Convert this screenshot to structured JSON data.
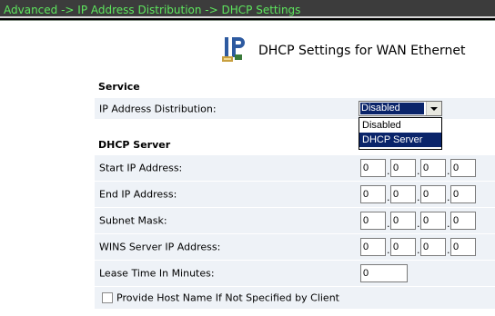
{
  "breadcrumb": "Advanced -> IP Address Distribution -> DHCP Settings",
  "page_title": "DHCP Settings for WAN Ethernet",
  "service": {
    "section_title": "Service",
    "ip_distribution_label": "IP Address Distribution:",
    "ip_distribution_value": "Disabled",
    "options": [
      "Disabled",
      "DHCP Server"
    ]
  },
  "dhcp_server": {
    "section_title": "DHCP Server",
    "start_ip": {
      "label": "Start IP Address:",
      "octets": [
        "0",
        "0",
        "0",
        "0"
      ]
    },
    "end_ip": {
      "label": "End IP Address:",
      "octets": [
        "0",
        "0",
        "0",
        "0"
      ]
    },
    "subnet_mask": {
      "label": "Subnet Mask:",
      "octets": [
        "0",
        "0",
        "0",
        "0"
      ]
    },
    "wins_ip": {
      "label": "WINS Server IP Address:",
      "octets": [
        "0",
        "0",
        "0",
        "0"
      ]
    },
    "lease_time": {
      "label": "Lease Time In Minutes:",
      "value": "0"
    },
    "provide_host_name": {
      "label": "Provide Host Name If Not Specified by Client",
      "checked": false
    }
  },
  "colors": {
    "breadcrumb_text": "#5ee65e",
    "row_background": "#eef2f7",
    "selection": "#0a246a"
  }
}
